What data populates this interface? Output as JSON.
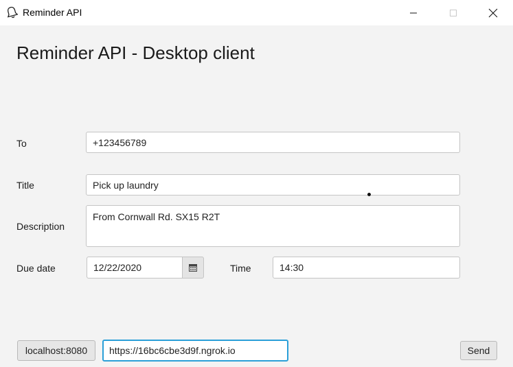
{
  "window": {
    "title": "Reminder API",
    "app_icon": "bell-icon",
    "controls": [
      "minimize-icon",
      "maximize-icon",
      "close-icon"
    ]
  },
  "heading": "Reminder API - Desktop client",
  "form": {
    "to": {
      "label": "To",
      "value": "+123456789"
    },
    "title": {
      "label": "Title",
      "value": "Pick up laundry"
    },
    "description": {
      "label": "Description",
      "value": "From Cornwall Rd. SX15 R2T"
    },
    "due_date": {
      "label": "Due date",
      "value": "12/22/2020",
      "picker_icon": "calendar-icon"
    },
    "time": {
      "label": "Time",
      "value": "14:30"
    }
  },
  "footer": {
    "server_button": "localhost:8080",
    "server_url": "https://16bc6cbe3d9f.ngrok.io",
    "send_button": "Send"
  },
  "colors": {
    "window_bg": "#f3f3f3",
    "focus_border": "#2a9fd8"
  }
}
